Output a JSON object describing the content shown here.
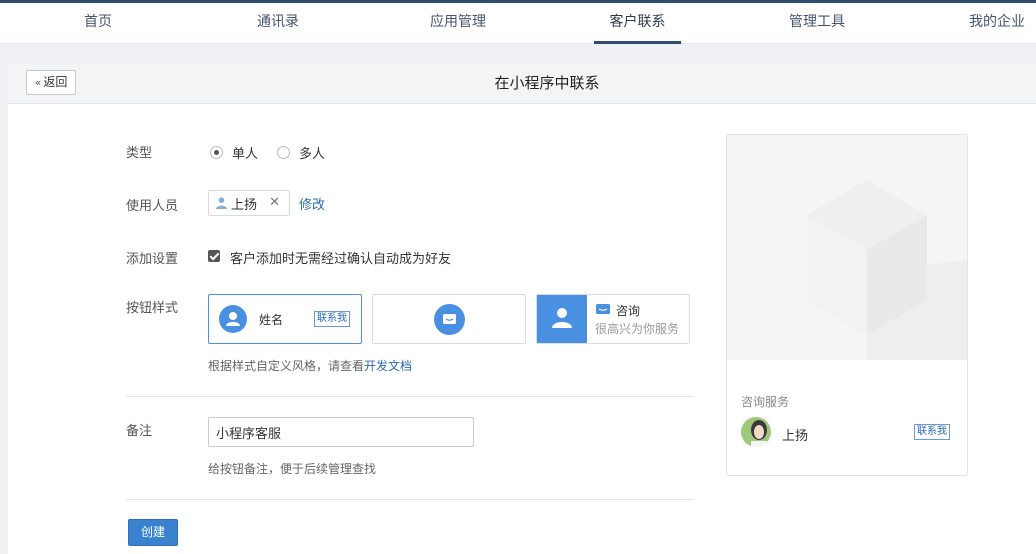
{
  "nav": {
    "items": [
      {
        "label": "首页"
      },
      {
        "label": "通讯录"
      },
      {
        "label": "应用管理"
      },
      {
        "label": "客户联系"
      },
      {
        "label": "管理工具"
      },
      {
        "label": "我的企业"
      }
    ],
    "active_index": 3
  },
  "header": {
    "back_label": "返回",
    "title": "在小程序中联系"
  },
  "form": {
    "type": {
      "label": "类型",
      "options": [
        {
          "label": "单人",
          "checked": true
        },
        {
          "label": "多人",
          "checked": false
        }
      ]
    },
    "users": {
      "label": "使用人员",
      "selected_user": "上扬",
      "modify_label": "修改"
    },
    "add_setting": {
      "label": "添加设置",
      "checkbox_label": "客户添加时无需经过确认自动成为好友",
      "checked": true
    },
    "button_style": {
      "label": "按钮样式",
      "style1": {
        "name": "姓名",
        "tag": "联系我"
      },
      "style3": {
        "title": "咨询",
        "subtitle": "很高兴为你服务"
      },
      "hint_prefix": "根据样式自定义风格，请查看",
      "hint_link": "开发文档"
    },
    "remark": {
      "label": "备注",
      "value": "小程序客服",
      "hint": "给按钮备注，便于后续管理查找"
    },
    "create_label": "创建"
  },
  "preview": {
    "title": "咨询服务",
    "name": "上扬",
    "tag": "联系我"
  },
  "colors": {
    "accent": "#4a90e2",
    "nav_dark": "#2f4b6e",
    "button": "#3a82d0"
  }
}
